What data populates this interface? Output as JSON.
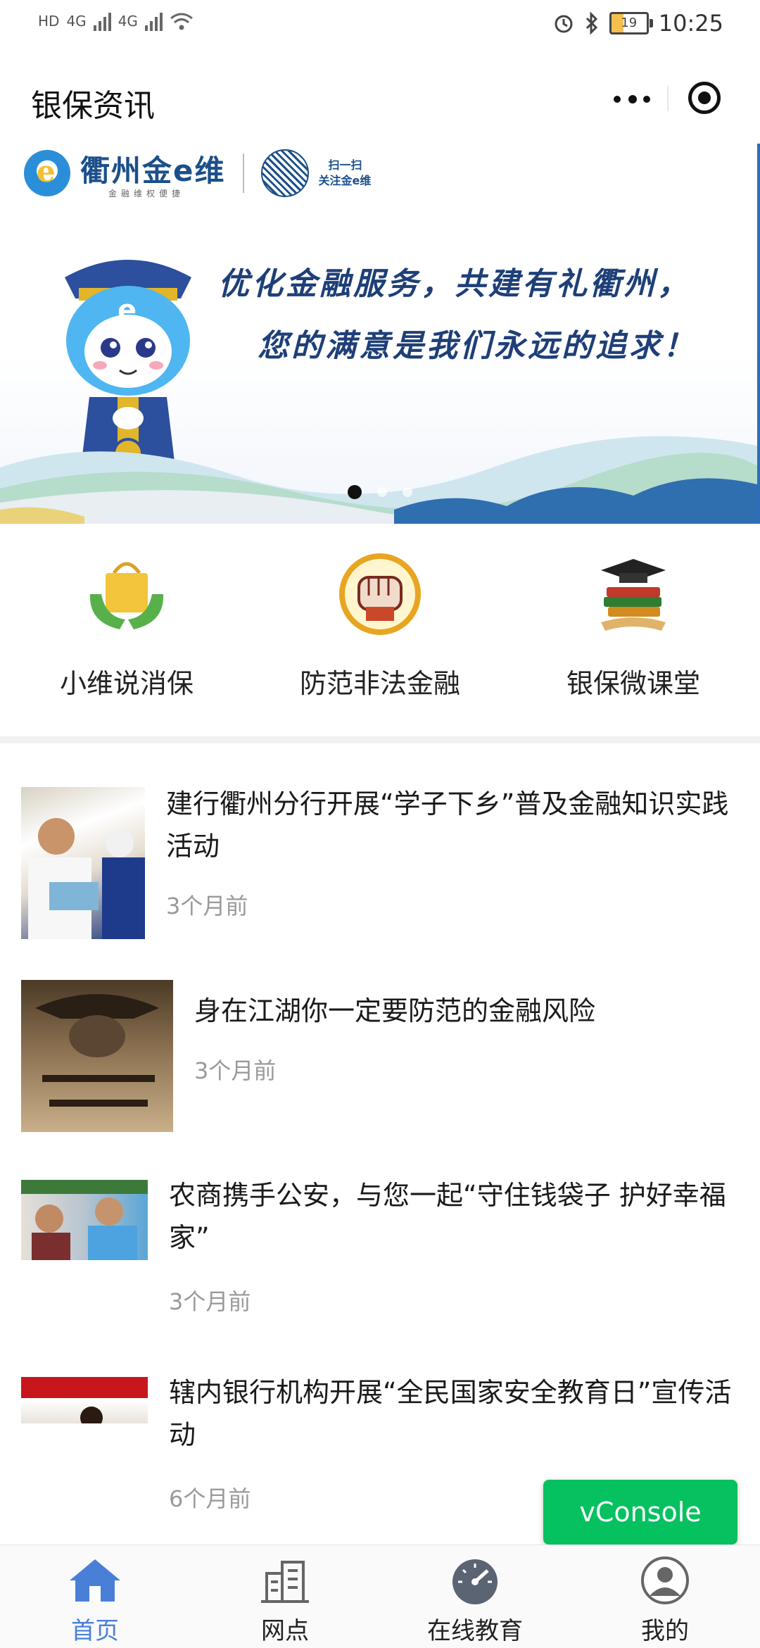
{
  "status_bar": {
    "left_labels": [
      "HD",
      "4G",
      "4G"
    ],
    "battery": "19",
    "time": "10:25"
  },
  "navbar": {
    "title": "银保资讯"
  },
  "banner": {
    "brand_name": "衢州金e维",
    "brand_tagline": "金融维权便捷",
    "qr_line1": "扫一扫",
    "qr_line2": "关注金e维",
    "slogan_line1": "优化金融服务，共建有礼衢州，",
    "slogan_line2": "您的满意是我们永远的追求！",
    "active_slide": 0,
    "slide_count": 3
  },
  "categories": [
    {
      "label": "小维说消保",
      "icon": "shopping-bag-hands-icon"
    },
    {
      "label": "防范非法金融",
      "icon": "fist-icon"
    },
    {
      "label": "银保微课堂",
      "icon": "graduation-books-icon"
    }
  ],
  "news": [
    {
      "title": "建行衢州分行开展“学子下乡”普及金融知识实践活动",
      "time": "3个月前"
    },
    {
      "title": "身在江湖你一定要防范的金融风险",
      "time": "3个月前"
    },
    {
      "title": "农商携手公安，与您一起“守住钱袋子 护好幸福家”",
      "time": "3个月前"
    },
    {
      "title": "辖内银行机构开展“全民国家安全教育日”宣传活动",
      "time": "6个月前"
    }
  ],
  "vconsole": "vConsole",
  "tabbar": [
    {
      "label": "首页",
      "icon": "home-icon",
      "active": true
    },
    {
      "label": "网点",
      "icon": "building-icon",
      "active": false
    },
    {
      "label": "在线教育",
      "icon": "gauge-icon",
      "active": false
    },
    {
      "label": "我的",
      "icon": "user-icon",
      "active": false
    }
  ],
  "colors": {
    "tab_active": "#4a7fd8",
    "vconsole_bg": "#05c160",
    "brand_blue": "#1e3f78"
  }
}
